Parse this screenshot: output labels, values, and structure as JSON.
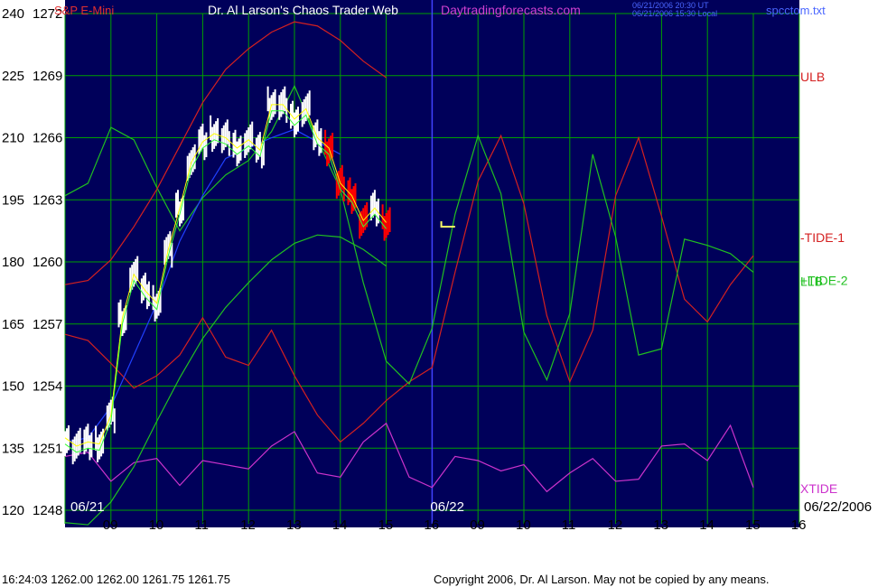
{
  "header": {
    "instrument": "S&P E-Mini",
    "title": "Dr. Al Larson's Chaos Trader Web",
    "site": "Daytradingforecasts.com",
    "utc_time": "06/21/2006 20:30 UT",
    "local_time": "06/21/2006 15:30 Local",
    "filename": "spcctom.txt"
  },
  "footer": {
    "status": "16:24:03   1262.00  1262.00  1261.75  1261.75",
    "copyright": "Copyright 2006, Dr. Al Larson. May not be copied by any means."
  },
  "chart_data": {
    "type": "line",
    "axes": {
      "left_scale": [
        "240",
        "225",
        "210",
        "195",
        "180",
        "165",
        "150",
        "135",
        "120"
      ],
      "price_scale": [
        "1272",
        "1269",
        "1266",
        "1263",
        "1260",
        "1257",
        "1254",
        "1251",
        "1248"
      ],
      "x_ticks": [
        "09",
        "10",
        "11",
        "12",
        "13",
        "14",
        "15",
        "16",
        "09",
        "10",
        "11",
        "12",
        "13",
        "14",
        "15",
        "16"
      ],
      "date_labels": [
        "06/21",
        "06/22",
        "06/22/2006"
      ]
    },
    "colors": {
      "background": "#00005a",
      "grid": "#00a000",
      "price_up": "#ffffff",
      "price_down": "#ff0000",
      "ulb": "#d42020",
      "llb": "#20c020",
      "tide1": "#d42020",
      "tide2": "#20c020",
      "xtide": "#cc33cc",
      "mavg_yellow": "#ffff00",
      "mavg_green": "#33ff33",
      "mavg_blue": "#2040ff",
      "divider": "#4040ff"
    },
    "series": [
      {
        "name": "ULB",
        "color": "#d42020",
        "x": [
          0,
          0.5,
          1,
          1.5,
          2,
          2.5,
          3,
          3.5,
          4,
          4.5,
          5,
          5.5,
          6,
          6.5,
          7
        ],
        "y": [
          1258.9,
          1259.1,
          1260.1,
          1261.7,
          1263.5,
          1265.6,
          1267.7,
          1269.3,
          1270.3,
          1271.1,
          1271.6,
          1271.4,
          1270.7,
          1269.7,
          1268.9
        ]
      },
      {
        "name": "LLB",
        "color": "#20c020",
        "x": [
          0,
          0.5,
          1,
          1.5,
          2,
          2.5,
          3,
          3.5,
          4,
          4.5,
          5,
          5.5,
          6,
          6.5,
          7
        ],
        "y": [
          1247.4,
          1247.3,
          1248.4,
          1250.1,
          1252.3,
          1254.4,
          1256.3,
          1257.8,
          1259.0,
          1260.1,
          1260.9,
          1261.3,
          1261.2,
          1260.6,
          1259.8
        ]
      },
      {
        "name": "-TIDE-1",
        "color": "#d42020",
        "x": [
          0,
          0.5,
          1,
          1.5,
          2,
          2.5,
          3,
          3.5,
          4,
          4.5,
          5,
          5.5,
          6,
          6.5,
          7,
          7.5,
          8,
          8.5,
          9,
          9.5,
          10,
          10.5,
          11,
          11.5,
          12,
          12.5,
          13,
          13.5,
          14,
          14.5,
          15
        ],
        "y": [
          1256.5,
          1256.2,
          1255.1,
          1253.9,
          1254.5,
          1255.5,
          1257.3,
          1255.4,
          1255.0,
          1256.7,
          1254.5,
          1252.6,
          1251.3,
          1252.2,
          1253.3,
          1254.2,
          1254.9,
          1259.5,
          1263.9,
          1266.1,
          1262.8,
          1257.4,
          1254.2,
          1256.7,
          1263.2,
          1266.0,
          1262.2,
          1258.2,
          1257.1,
          1258.9,
          1260.3
        ]
      },
      {
        "name": "+TIDE-2",
        "color": "#20c020",
        "x": [
          0,
          0.5,
          1,
          1.5,
          2,
          2.5,
          3,
          3.5,
          4,
          4.5,
          5,
          5.5,
          6,
          6.5,
          7,
          7.5,
          8,
          8.5,
          9,
          9.5,
          10,
          10.5,
          11,
          11.5,
          12,
          12.5,
          13,
          13.5,
          14,
          14.5,
          15
        ],
        "y": [
          1263.2,
          1263.8,
          1266.5,
          1265.9,
          1263.6,
          1261.5,
          1263.1,
          1264.2,
          1264.9,
          1266.3,
          1268.5,
          1265.9,
          1263.5,
          1259.0,
          1255.2,
          1254.1,
          1256.8,
          1262.3,
          1266.1,
          1263.3,
          1256.6,
          1254.3,
          1257.5,
          1265.2,
          1261.2,
          1255.5,
          1255.8,
          1261.1,
          1260.8,
          1260.4,
          1259.5
        ]
      },
      {
        "name": "XTIDE",
        "color": "#cc33cc",
        "x": [
          0,
          0.5,
          1,
          1.5,
          2,
          2.5,
          3,
          3.5,
          4,
          4.5,
          5,
          5.5,
          6,
          6.5,
          7,
          7.5,
          8,
          8.5,
          9,
          9.5,
          10,
          10.5,
          11,
          11.5,
          12,
          12.5,
          13,
          13.5,
          14,
          14.5,
          15
        ],
        "y": [
          1250.6,
          1250.8,
          1249.4,
          1250.3,
          1250.5,
          1249.2,
          1250.4,
          1250.2,
          1250.0,
          1251.1,
          1251.8,
          1249.8,
          1249.6,
          1251.3,
          1252.2,
          1249.6,
          1249.1,
          1250.6,
          1250.4,
          1249.9,
          1250.2,
          1248.9,
          1249.8,
          1250.5,
          1249.4,
          1249.5,
          1251.1,
          1251.2,
          1250.4,
          1252.1,
          1249.1
        ]
      },
      {
        "name": "price",
        "color": "#ffffff",
        "x": [
          0,
          0.25,
          0.5,
          0.75,
          1,
          1.25,
          1.5,
          1.75,
          2,
          2.25,
          2.5,
          2.75,
          3,
          3.25,
          3.5,
          3.75,
          4,
          4.25,
          4.5,
          4.75,
          5,
          5.25,
          5.5,
          5.75,
          6,
          6.25,
          6.5,
          6.75,
          7
        ],
        "y": [
          1251.5,
          1251.1,
          1251.3,
          1251.2,
          1252.6,
          1257.3,
          1259.4,
          1258.6,
          1258.0,
          1260.6,
          1262.6,
          1264.8,
          1265.8,
          1266.2,
          1266.0,
          1265.5,
          1265.9,
          1265.4,
          1267.6,
          1267.6,
          1266.9,
          1267.4,
          1266.0,
          1265.5,
          1263.8,
          1263.2,
          1262.0,
          1262.6,
          1261.9
        ]
      },
      {
        "name": "blue",
        "color": "#2040ff",
        "x": [
          0,
          0.5,
          1,
          1.5,
          2,
          2.5,
          3,
          3.5,
          4,
          4.5,
          5,
          5.5,
          6
        ],
        "y": [
          1251.3,
          1251.5,
          1253.0,
          1255.5,
          1258.0,
          1261.0,
          1263.2,
          1265.0,
          1265.5,
          1266.0,
          1266.4,
          1265.8,
          1265.2
        ]
      }
    ],
    "marker": {
      "price": 1261.7
    }
  }
}
